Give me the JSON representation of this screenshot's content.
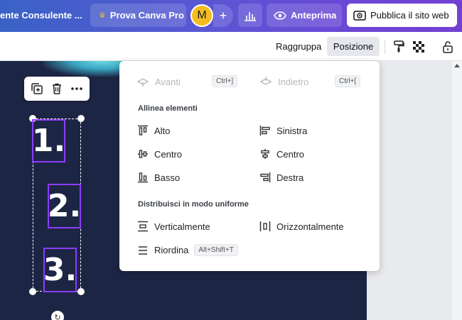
{
  "topbar": {
    "doc_title": "ente Consulente ...",
    "pro_label": "Prova Canva Pro",
    "avatar_initial": "M",
    "plus_label": "+",
    "preview_label": "Anteprima",
    "publish_label": "Pubblica il sito web"
  },
  "toolbar": {
    "group_label": "Raggruppa",
    "position_label": "Posizione"
  },
  "menu": {
    "forward_label": "Avanti",
    "forward_shortcut": "Ctrl+]",
    "backward_label": "Indietro",
    "backward_shortcut": "Ctrl+[",
    "align_section": "Allinea elementi",
    "align": {
      "top": "Alto",
      "center_v": "Centro",
      "bottom": "Basso",
      "left": "Sinistra",
      "center_h": "Centro",
      "right": "Destra"
    },
    "distribute_section": "Distribuisci in modo uniforme",
    "vertical": "Verticalmente",
    "horizontal": "Orizzontalmente",
    "reorder": "Riordina",
    "reorder_shortcut": "Alt+Shift+T"
  },
  "canvas": {
    "numbers": [
      "1.",
      "2.",
      "3."
    ]
  },
  "colors": {
    "accent": "#8b3dff",
    "canvas_bg": "#1d2544",
    "topbar_start": "#3a62c6",
    "topbar_end": "#7340d1"
  }
}
